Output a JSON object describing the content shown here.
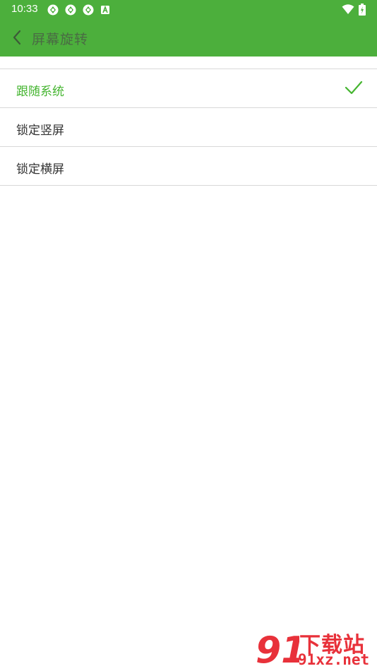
{
  "status_bar": {
    "time": "10:33",
    "left_icons": [
      "sync-icon",
      "sync-icon",
      "sync-icon",
      "a-badge-icon"
    ],
    "right_icons": [
      "wifi-icon",
      "battery-icon"
    ]
  },
  "app_bar": {
    "title": "屏幕旋转",
    "back_icon": "chevron-left-icon",
    "background_color": "#4caf3c"
  },
  "options": {
    "items": [
      {
        "label": "跟随系统",
        "selected": true
      },
      {
        "label": "锁定竖屏",
        "selected": false
      },
      {
        "label": "锁定横屏",
        "selected": false
      }
    ],
    "selected_color": "#45b530",
    "check_icon": "check-icon"
  },
  "watermark": {
    "logo_text": "91",
    "title": "下载站",
    "domain": "91xz.net",
    "color": "#e8313a"
  }
}
